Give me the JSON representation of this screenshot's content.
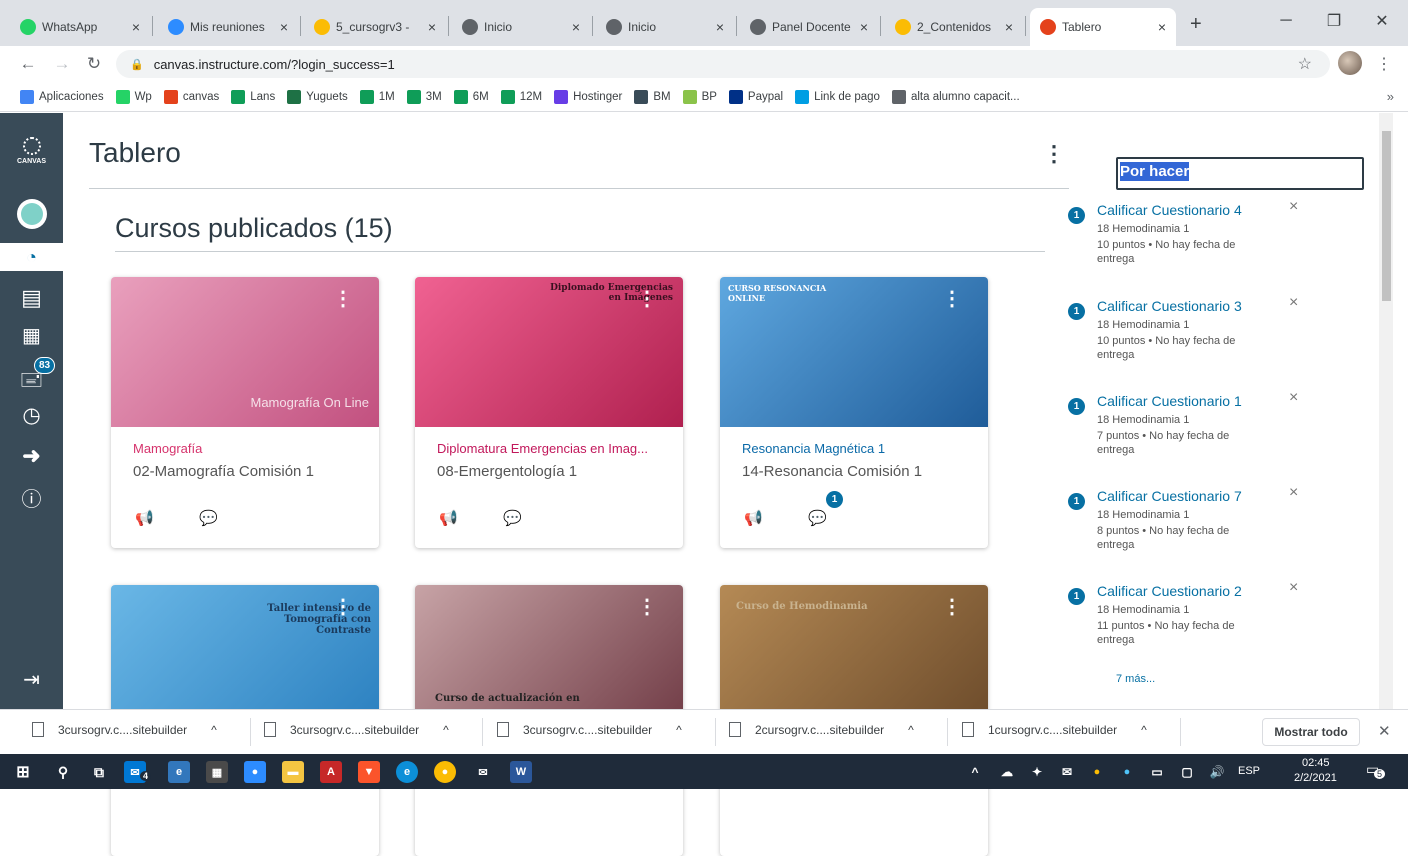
{
  "browser": {
    "tabs": [
      {
        "label": "WhatsApp",
        "color": "#25d366"
      },
      {
        "label": "Mis reuniones",
        "color": "#2d8cff"
      },
      {
        "label": "5_cursogrv3 - ",
        "color": "#fbbc04"
      },
      {
        "label": "Inicio",
        "color": "#5f6368"
      },
      {
        "label": "Inicio",
        "color": "#5f6368"
      },
      {
        "label": "Panel Docente",
        "color": "#5f6368"
      },
      {
        "label": "2_Contenidos",
        "color": "#fbbc04"
      },
      {
        "label": "Tablero",
        "color": "#e4421c"
      }
    ],
    "url": "canvas.instructure.com/?login_success=1",
    "bookmarks": [
      {
        "label": "Aplicaciones",
        "color": "#4285f4"
      },
      {
        "label": "Wp",
        "color": "#25d366"
      },
      {
        "label": "canvas",
        "color": "#e4421c"
      },
      {
        "label": "Lans",
        "color": "#0f9d58"
      },
      {
        "label": "Yuguets",
        "color": "#1e7145"
      },
      {
        "label": "1M",
        "color": "#0f9d58"
      },
      {
        "label": "3M",
        "color": "#0f9d58"
      },
      {
        "label": "6M",
        "color": "#0f9d58"
      },
      {
        "label": "12M",
        "color": "#0f9d58"
      },
      {
        "label": "Hostinger",
        "color": "#673de6"
      },
      {
        "label": "BM",
        "color": "#394b58"
      },
      {
        "label": "BP",
        "color": "#8bc34a"
      },
      {
        "label": "Paypal",
        "color": "#003087"
      },
      {
        "label": "Link de pago",
        "color": "#009ee3"
      },
      {
        "label": "alta alumno capacit...",
        "color": "#5f6368"
      }
    ],
    "bookmarks_more": "»"
  },
  "sidebar": {
    "logo": "CANVAS",
    "badge": "83"
  },
  "page": {
    "title": "Tablero",
    "section": "Cursos publicados (15)"
  },
  "courses": [
    {
      "title": "Mamografía",
      "subtitle": "02-Mamografía Comisión 1",
      "color": "#d6336c",
      "img1": "#e9a0bd",
      "img2": "#c2507f",
      "overlay": "Mamografía On Line",
      "badge": ""
    },
    {
      "title": "Diplomatura Emergencias en Imag...",
      "subtitle": "08-Emergentología 1",
      "color": "#c2185b",
      "img1": "#f06292",
      "img2": "#b0204f",
      "overlay": "Diplomado Emergencias en Imágenes",
      "badge": ""
    },
    {
      "title": "Resonancia Magnética 1",
      "subtitle": "14-Resonancia Comisión 1",
      "color": "#0b6aa8",
      "img1": "#5fa8e0",
      "img2": "#1f5c99",
      "overlay": "CURSO RESONANCIA ONLINE",
      "badge": "1"
    },
    {
      "title": "",
      "subtitle": "",
      "color": "#1e88c7",
      "img1": "#6ab7e6",
      "img2": "#2a7fbf",
      "overlay": "Taller intensivo de Tomografía con Contraste",
      "badge": ""
    },
    {
      "title": "",
      "subtitle": "",
      "color": "#8b5a63",
      "img1": "#c7a3a6",
      "img2": "#6f3a44",
      "overlay": "Curso de actualización en",
      "badge": ""
    },
    {
      "title": "",
      "subtitle": "",
      "color": "#8a6d3b",
      "img1": "#b58a55",
      "img2": "#6b4a2a",
      "overlay": "Curso de Hemodinamia",
      "badge": ""
    }
  ],
  "todo": {
    "header": "Por hacer",
    "items": [
      {
        "count": "1",
        "title": "Calificar Cuestionario 4",
        "course": "18 Hemodinamia 1",
        "detail": "10 puntos • No hay fecha de entrega"
      },
      {
        "count": "1",
        "title": "Calificar Cuestionario 3",
        "course": "18 Hemodinamia 1",
        "detail": "10 puntos • No hay fecha de entrega"
      },
      {
        "count": "1",
        "title": "Calificar Cuestionario 1",
        "course": "18 Hemodinamia 1",
        "detail": "7 puntos • No hay fecha de entrega"
      },
      {
        "count": "1",
        "title": "Calificar Cuestionario 7",
        "course": "18 Hemodinamia 1",
        "detail": "8 puntos • No hay fecha de entrega"
      },
      {
        "count": "1",
        "title": "Calificar Cuestionario 2",
        "course": "18 Hemodinamia 1",
        "detail": "11 puntos • No hay fecha de entrega"
      }
    ],
    "more": "7 más..."
  },
  "downloads": {
    "files": [
      "3cursogrv.c....sitebuilder",
      "3cursogrv.c....sitebuilder",
      "3cursogrv.c....sitebuilder",
      "2cursogrv.c....sitebuilder",
      "1cursogrv.c....sitebuilder"
    ],
    "show_all": "Mostrar todo"
  },
  "taskbar": {
    "lang": "ESP",
    "time": "02:45",
    "date": "2/2/2021",
    "notif": "5",
    "mail_badge": "4"
  }
}
